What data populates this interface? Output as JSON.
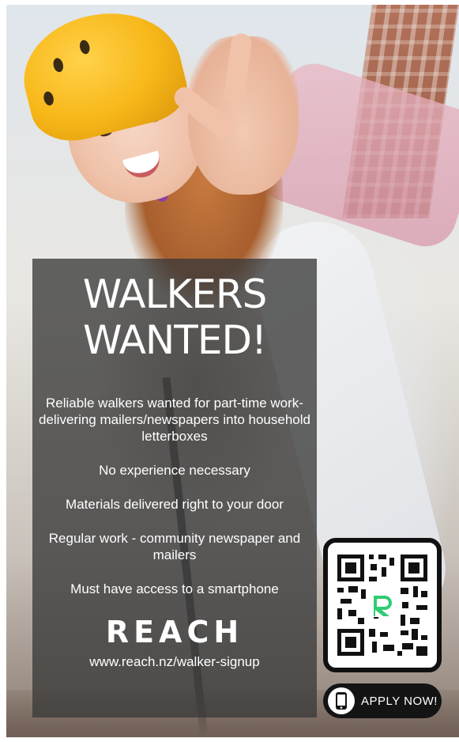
{
  "headline": {
    "line1": "WALKERS",
    "line2": "WANTED!"
  },
  "info": {
    "description": "Reliable walkers wanted for part-time work- delivering mailers/newspapers into household letterboxes",
    "no_experience": "No experience necessary",
    "materials": "Materials delivered right to your door",
    "regular_work": "Regular work - community newspaper and mailers",
    "smartphone": "Must have access to a smartphone"
  },
  "brand": {
    "name": "REACH",
    "url": "www.reach.nz/walker-signup",
    "accent_color": "#2fcc71"
  },
  "apply": {
    "label": "APPLY NOW!",
    "icon": "smartphone-icon"
  },
  "colors": {
    "panel": "#3a3a3a",
    "helmet": "#f7b718",
    "qr_frame": "#111111"
  }
}
